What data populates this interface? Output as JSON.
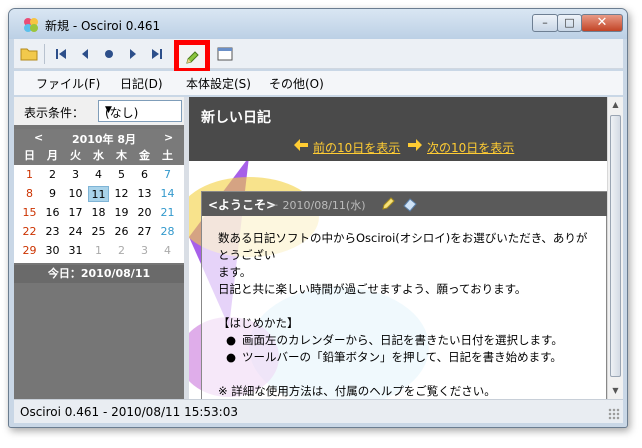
{
  "window": {
    "title": "新規 - Osciroi 0.461"
  },
  "titlebar": {
    "minimize": "–",
    "maximize": "□",
    "close": "✕"
  },
  "toolbar": {
    "icons": [
      "open-folder",
      "first-page",
      "prev-page",
      "record",
      "next-page",
      "last-page",
      "pencil-edit",
      "window-view"
    ]
  },
  "menu": {
    "items": [
      "ファイル(F)",
      "日記(D)",
      "本体設定(S)",
      "その他(O)"
    ]
  },
  "filter": {
    "label": "表示条件：",
    "value": "(なし)"
  },
  "calendar": {
    "prev": "<",
    "next": ">",
    "month_label": "2010年  8月",
    "weekdays": [
      "日",
      "月",
      "火",
      "水",
      "木",
      "金",
      "土"
    ],
    "weeks": [
      [
        "1",
        "2",
        "3",
        "4",
        "5",
        "6",
        "7"
      ],
      [
        "8",
        "9",
        "10",
        "11",
        "12",
        "13",
        "14"
      ],
      [
        "15",
        "16",
        "17",
        "18",
        "19",
        "20",
        "21"
      ],
      [
        "22",
        "23",
        "24",
        "25",
        "26",
        "27",
        "28"
      ],
      [
        "29",
        "30",
        "31",
        "1",
        "2",
        "3",
        "4"
      ]
    ],
    "selected_day": "11",
    "today_label": "今日：2010/08/11"
  },
  "content": {
    "title": "新しい日記",
    "prev_link": "前の10日を表示",
    "next_link": "次の10日を表示"
  },
  "entry": {
    "title": "<ようこそ>",
    "date": "－ 2010/08/11(水)",
    "line1": "数ある日記ソフトの中からOsciroi(オシロイ)をお選びいただき、ありがとうござい",
    "line2": "ます。",
    "line3": "日記と共に楽しい時間が過ごせますよう、願っております。",
    "heading": "【はじめかた】",
    "bullet1": "画面左のカレンダーから、日記を書きたい日付を選択します。",
    "bullet2": "ツールバーの「鉛筆ボタン」を押して、日記を書き始めます。",
    "note": "※ 詳細な使用方法は、付属のヘルプをご覧ください。"
  },
  "status": {
    "text": "Osciroi 0.461 - 2010/08/11 15:53:03"
  },
  "colors": {
    "highlight_red": "#ff0000",
    "link_gold": "#ffcc33",
    "sunday": "#cc3300",
    "saturday": "#3399cc"
  }
}
